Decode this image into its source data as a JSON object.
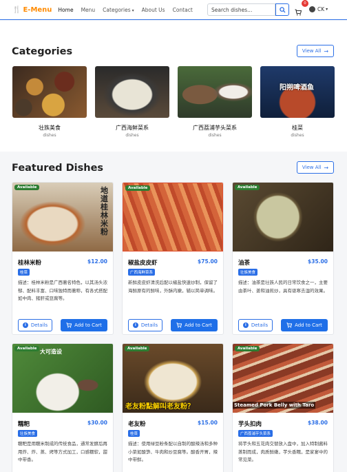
{
  "navbar": {
    "brand_prefix": "E-",
    "brand_suffix": "Menu",
    "links": [
      "Home",
      "Menu",
      "Categories",
      "About Us",
      "Contact"
    ],
    "search_placeholder": "Search dishes...",
    "cart_count": "0",
    "user_initials": "CK"
  },
  "categories": {
    "title": "Categories",
    "view_all": "View All",
    "items": [
      {
        "name": "壮族美食",
        "sub": "dishes"
      },
      {
        "name": "广西海鲜菜系",
        "sub": "dishes"
      },
      {
        "name": "广西荔浦芋头菜系",
        "sub": "dishes"
      },
      {
        "name": "桂菜",
        "sub": "dishes",
        "image_text": "阳朔啤酒鱼"
      }
    ]
  },
  "featured": {
    "title": "Featured Dishes",
    "view_all": "View All",
    "available_label": "Available",
    "details_label": "Details",
    "add_label": "Add to Cart",
    "dishes": [
      {
        "name": "桂林米粉",
        "price": "$12.00",
        "tag": "桂菜",
        "desc": "描述：桂林米粉是广西著名特色，以其汤头浓郁、配料丰富、口味独特而著称，有各式搭配如中肉、猪肝或豆腐等。",
        "image_text": "地道桂林米粉"
      },
      {
        "name": "椒盐皮皮虾",
        "price": "$75.00",
        "tag": "广西海鲜菜系",
        "desc": "新鲜皮皮虾清洗后配以椒盐快速炒制，保留了海鲜原有的鲜味，外酥内嫩，辅以简单调味。"
      },
      {
        "name": "油茶",
        "price": "$35.00",
        "tag": "壮族美食",
        "desc": "描述：油茶是壮族人民的日常饮食之一，主要由茶叶、姜和油煎炒，具有驱寒去湿的效果。"
      },
      {
        "name": "糯粑",
        "price": "$30.00",
        "tag": "壮族美食",
        "desc": "糯粑是用糯米制成的传统食品，通常发酵后再用炸、炸、蒸、烤等方式加工，口感糯软，甜中带香。",
        "image_text": "大可造设"
      },
      {
        "name": "老友粉",
        "price": "$15.00",
        "tag": "桂菜",
        "desc": "描述：使用绿豆粉条配以自制的酸辣汤和多种小菜如酸笋、牛肉和炒豆腐等。酸香开胃，辣中带鲜。",
        "image_text": "老友粉點解叫老友粉？"
      },
      {
        "name": "芋头扣肉",
        "price": "$38.00",
        "tag": "广西荔浦芋头菜系",
        "desc": "将芋头和五花肉交替放入盘中，加入特制酱料蒸制而成，肉质鲜嫩，芋头香糯，是家宴中的常见菜。",
        "image_text": "Steamed Pork Belly with Taro"
      }
    ]
  },
  "colors": {
    "accent": "#2a6ee6",
    "brand_orange": "#ff8a00",
    "available_green": "#2e7d32",
    "badge_red": "#e53935"
  }
}
